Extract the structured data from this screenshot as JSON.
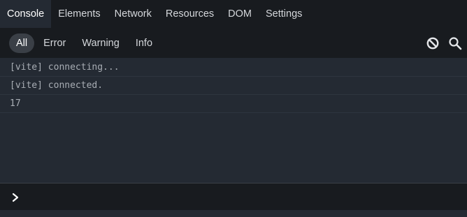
{
  "tabs": [
    {
      "label": "Console",
      "active": true
    },
    {
      "label": "Elements",
      "active": false
    },
    {
      "label": "Network",
      "active": false
    },
    {
      "label": "Resources",
      "active": false
    },
    {
      "label": "DOM",
      "active": false
    },
    {
      "label": "Settings",
      "active": false
    }
  ],
  "filters": [
    {
      "label": "All",
      "active": true
    },
    {
      "label": "Error",
      "active": false
    },
    {
      "label": "Warning",
      "active": false
    },
    {
      "label": "Info",
      "active": false
    }
  ],
  "toolbar": {
    "clear_icon": "clear-console-icon",
    "search_icon": "search-icon"
  },
  "log": {
    "entries": [
      "[vite] connecting...",
      "[vite] connected.",
      "17"
    ]
  },
  "prompt": {
    "icon": "chevron-right-icon",
    "value": ""
  },
  "colors": {
    "bar_background": "#181b1f",
    "panel_background": "#242a33",
    "text": "#d4d7db",
    "log_text": "#a8adb4"
  }
}
